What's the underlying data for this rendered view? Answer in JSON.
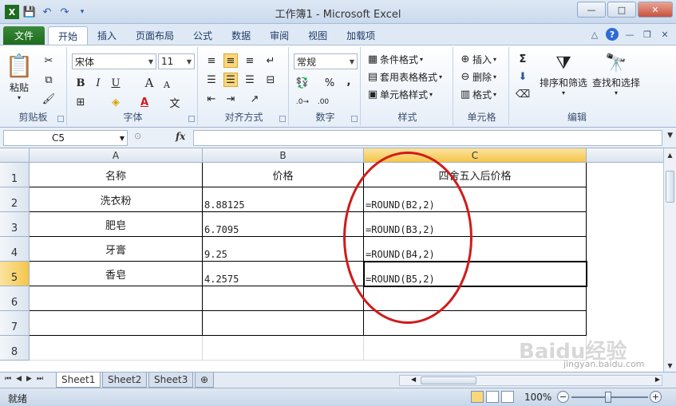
{
  "window": {
    "title": "工作簿1 - Microsoft Excel"
  },
  "ribbon_tabs": [
    "文件",
    "开始",
    "插入",
    "页面布局",
    "公式",
    "数据",
    "审阅",
    "视图",
    "加载项"
  ],
  "ribbon": {
    "clipboard": {
      "paste": "粘贴",
      "label": "剪贴板"
    },
    "font": {
      "name": "宋体",
      "size": "11",
      "bold": "B",
      "italic": "I",
      "underline": "U",
      "grow": "A",
      "shrink": "A",
      "label": "字体"
    },
    "alignment": {
      "label": "对齐方式"
    },
    "number": {
      "format": "常规",
      "percent": "%",
      "comma": ",",
      "label": "数字"
    },
    "styles": {
      "conditional": "条件格式",
      "table": "套用表格格式",
      "cell": "单元格样式",
      "label": "样式"
    },
    "cells": {
      "insert": "插入",
      "delete": "删除",
      "format": "格式",
      "label": "单元格"
    },
    "editing": {
      "sigma": "Σ",
      "sort": "排序和筛选",
      "find": "查找和选择",
      "label": "编辑"
    }
  },
  "formula_bar": {
    "name_box": "C5",
    "fx": "fx",
    "value": ""
  },
  "columns": [
    "A",
    "B",
    "C"
  ],
  "rows": [
    {
      "num": "1",
      "a": "名称",
      "b": "价格",
      "c": "四舍五入后价格"
    },
    {
      "num": "2",
      "a": "洗衣粉",
      "b": "8.88125",
      "c": "=ROUND(B2,2)"
    },
    {
      "num": "3",
      "a": "肥皂",
      "b": "6.7095",
      "c": "=ROUND(B3,2)"
    },
    {
      "num": "4",
      "a": "牙膏",
      "b": "9.25",
      "c": "=ROUND(B4,2)"
    },
    {
      "num": "5",
      "a": "香皂",
      "b": "4.2575",
      "c": "=ROUND(B5,2)"
    },
    {
      "num": "6",
      "a": "",
      "b": "",
      "c": ""
    },
    {
      "num": "7",
      "a": "",
      "b": "",
      "c": ""
    },
    {
      "num": "8",
      "a": "",
      "b": "",
      "c": ""
    }
  ],
  "sheet_tabs": [
    "Sheet1",
    "Sheet2",
    "Sheet3"
  ],
  "status": {
    "text": "就绪",
    "zoom": "100%"
  },
  "colors": {
    "accent": "#f5c64a",
    "annotation": "#d11a1a",
    "file_tab": "#1f6b1f"
  },
  "watermark": {
    "logo": "Baidu经验",
    "url": "jingyan.baidu.com"
  }
}
